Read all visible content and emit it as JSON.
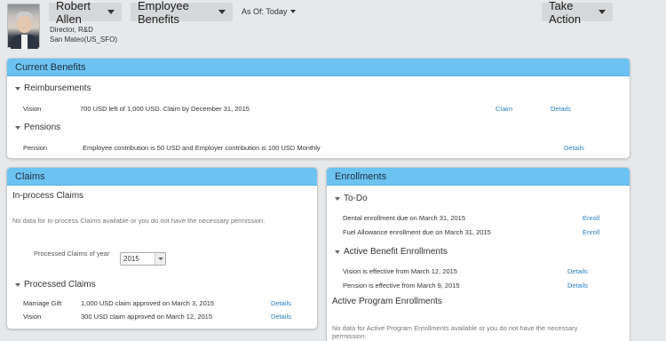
{
  "header": {
    "person_name": "Robert Allen",
    "title": "Director, R&D",
    "location": "San Mateo(US_SFO)",
    "section_menu": "Employee Benefits",
    "as_of": "As Of: Today",
    "take_action": "Take Action"
  },
  "current_benefits": {
    "title": "Current Benefits",
    "reimbursements": {
      "heading": "Reimbursements",
      "rows": [
        {
          "name": "Vision",
          "desc": "700 USD left of 1,000 USD. Claim by December 31, 2015",
          "claim": "Claim",
          "details": "Details"
        }
      ]
    },
    "pensions": {
      "heading": "Pensions",
      "rows": [
        {
          "name": "Pension",
          "desc": "Employee contribution is 50 USD and Employer contribution is 100 USD Monthly",
          "details": "Details"
        }
      ]
    }
  },
  "claims": {
    "title": "Claims",
    "in_process_heading": "In-process Claims",
    "in_process_empty": "No data for In-process Claims available or you do not have the necessary permission.",
    "processed_of_year_label": "Processed Claims of year",
    "year_value": "2015",
    "processed_heading": "Processed Claims",
    "rows": [
      {
        "name": "Marriage Gift",
        "desc": "1,000 USD claim approved on March 3, 2015",
        "details": "Details"
      },
      {
        "name": "Vision",
        "desc": "300 USD claim approved on March 12, 2015",
        "details": "Details"
      }
    ]
  },
  "enrollments": {
    "title": "Enrollments",
    "todo_heading": "To-Do",
    "todo_rows": [
      {
        "desc": "Dental enrollment due on March 31, 2015",
        "action": "Enroll"
      },
      {
        "desc": "Fuel Allowance enrollment due on March 31, 2015",
        "action": "Enroll"
      }
    ],
    "active_heading": "Active Benefit Enrollments",
    "active_rows": [
      {
        "desc": "Vision is effective from March 12, 2015",
        "details": "Details"
      },
      {
        "desc": "Pension is effective from March 9, 2015",
        "details": "Details"
      }
    ],
    "program_heading": "Active Program Enrollments",
    "program_empty_1": "No data for Active Program Enrollments available or you do not have the necessary",
    "program_empty_2": "permission."
  }
}
